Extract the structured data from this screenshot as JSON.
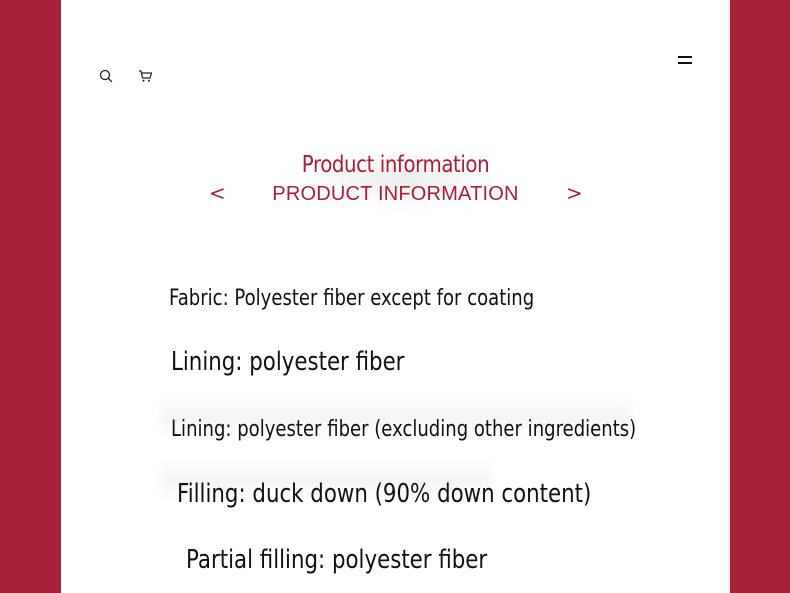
{
  "header": {
    "search_icon": "search-icon",
    "cart_icon": "cart-icon",
    "menu_icon": "hamburger-menu-icon"
  },
  "title_section": {
    "title": "Product information",
    "subtitle": "PRODUCT INFORMATION",
    "prev_arrow": "<",
    "next_arrow": ">"
  },
  "product_info": {
    "lines": [
      "Fabric: Polyester fiber except for coating",
      "Lining: polyester fiber",
      "Lining: polyester fiber (excluding other ingredients)",
      "Filling: duck down (90% down content)",
      "Partial filling: polyester fiber"
    ]
  },
  "colors": {
    "brand": "#a52137",
    "background": "#ffffff",
    "text": "#111111"
  }
}
